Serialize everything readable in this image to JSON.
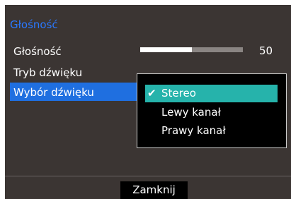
{
  "menu": {
    "title": "Głośność",
    "items": [
      {
        "label": "Głośność"
      },
      {
        "label": "Tryb dźwięku"
      },
      {
        "label": "Wybór dźwięku"
      }
    ]
  },
  "volume": {
    "value": "50",
    "fraction": 0.5
  },
  "dropdown": {
    "options": [
      {
        "label": "Stereo",
        "selected": true,
        "check": "✔"
      },
      {
        "label": "Lewy kanał",
        "selected": false
      },
      {
        "label": "Prawy kanał",
        "selected": false
      }
    ]
  },
  "footer": {
    "close_label": "Zamknij"
  },
  "colors": {
    "background": "#3b3533",
    "accent_title": "#2a78ff",
    "selected_row": "#1f6fe0",
    "selected_option": "#26b3ab"
  }
}
